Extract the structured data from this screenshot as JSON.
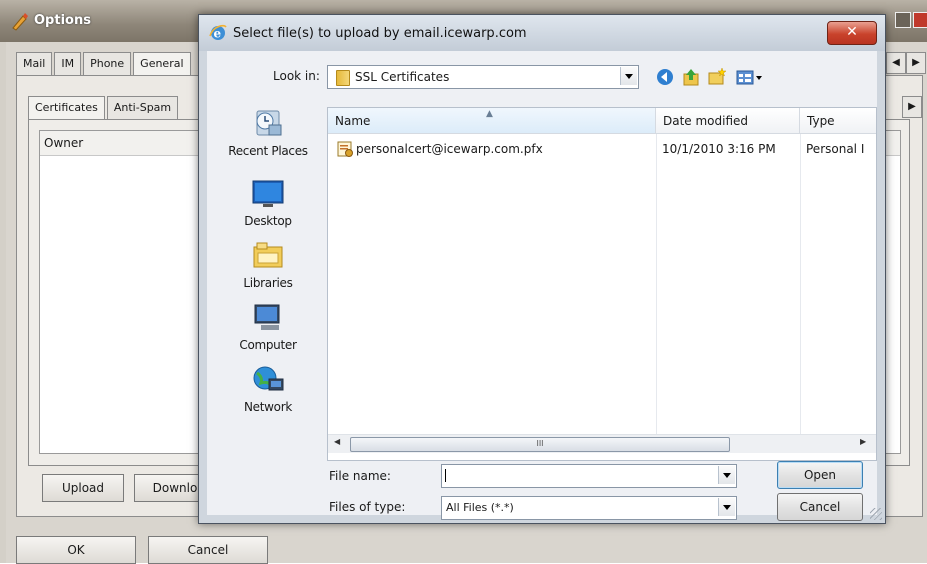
{
  "options_window": {
    "title": "Options",
    "top_tabs": [
      "Mail",
      "IM",
      "Phone",
      "General"
    ],
    "sub_tabs": [
      "Certificates",
      "Anti-Spam"
    ],
    "list_header": "Owner",
    "upload_label": "Upload",
    "download_label": "Downlo",
    "ok_label": "OK",
    "cancel_label": "Cancel",
    "scroll_left": "◀",
    "scroll_right": "▶",
    "subscroll_right": "▶"
  },
  "dialog": {
    "title": "Select file(s) to upload by email.icewarp.com",
    "close_label": "✕",
    "look_in_label": "Look in:",
    "look_in_value": "SSL Certificates",
    "toolbar_icons": [
      "back-icon",
      "up-folder-icon",
      "new-folder-icon",
      "view-menu-icon"
    ],
    "places": [
      {
        "label": "Recent Places",
        "icon": "recent-places-icon"
      },
      {
        "label": "Desktop",
        "icon": "desktop-icon"
      },
      {
        "label": "Libraries",
        "icon": "libraries-icon"
      },
      {
        "label": "Computer",
        "icon": "computer-icon"
      },
      {
        "label": "Network",
        "icon": "network-icon"
      }
    ],
    "columns": [
      "Name",
      "Date modified",
      "Type"
    ],
    "files": [
      {
        "name": "personalcert@icewarp.com.pfx",
        "date": "10/1/2010 3:16 PM",
        "type": "Personal I"
      }
    ],
    "scroll_thumb_grip": "III",
    "scroll_left": "◀",
    "scroll_right": "▶",
    "file_name_label": "File name:",
    "file_name_value": "",
    "files_of_type_label": "Files of type:",
    "files_of_type_value": "All Files (*.*)",
    "open_label": "Open",
    "cancel_label": "Cancel"
  }
}
